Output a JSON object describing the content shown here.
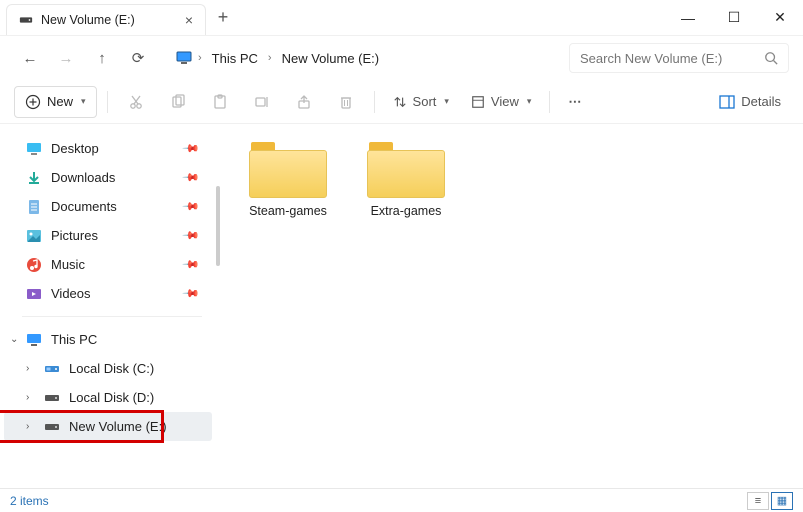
{
  "window": {
    "tab_title": "New Volume (E:)",
    "new_tab_tooltip": "+",
    "minimize": "—",
    "maximize": "☐",
    "close": "✕"
  },
  "nav": {
    "back": "←",
    "forward": "→",
    "up": "↑",
    "refresh": "⟳"
  },
  "breadcrumbs": {
    "root_icon": "monitor",
    "items": [
      "This PC",
      "New Volume (E:)"
    ]
  },
  "search": {
    "placeholder": "Search New Volume (E:)"
  },
  "toolbar": {
    "new_label": "New",
    "cut": "Cut",
    "copy": "Copy",
    "paste": "Paste",
    "rename": "Rename",
    "share": "Share",
    "delete": "Delete",
    "sort_label": "Sort",
    "view_label": "View",
    "more": "⋯",
    "details_label": "Details"
  },
  "sidebar": {
    "quick": [
      {
        "label": "Desktop",
        "icon": "desktop",
        "pinned": true
      },
      {
        "label": "Downloads",
        "icon": "download",
        "pinned": true
      },
      {
        "label": "Documents",
        "icon": "document",
        "pinned": true
      },
      {
        "label": "Pictures",
        "icon": "picture",
        "pinned": true
      },
      {
        "label": "Music",
        "icon": "music",
        "pinned": true
      },
      {
        "label": "Videos",
        "icon": "video",
        "pinned": true
      }
    ],
    "thispc_label": "This PC",
    "drives": [
      {
        "label": "Local Disk (C:)",
        "icon": "drive-os"
      },
      {
        "label": "Local Disk (D:)",
        "icon": "drive"
      },
      {
        "label": "New Volume (E:)",
        "icon": "drive",
        "selected": true,
        "highlighted": true
      }
    ]
  },
  "content": {
    "folders": [
      {
        "name": "Steam-games"
      },
      {
        "name": "Extra-games"
      }
    ]
  },
  "statusbar": {
    "count_label": "2 items"
  }
}
